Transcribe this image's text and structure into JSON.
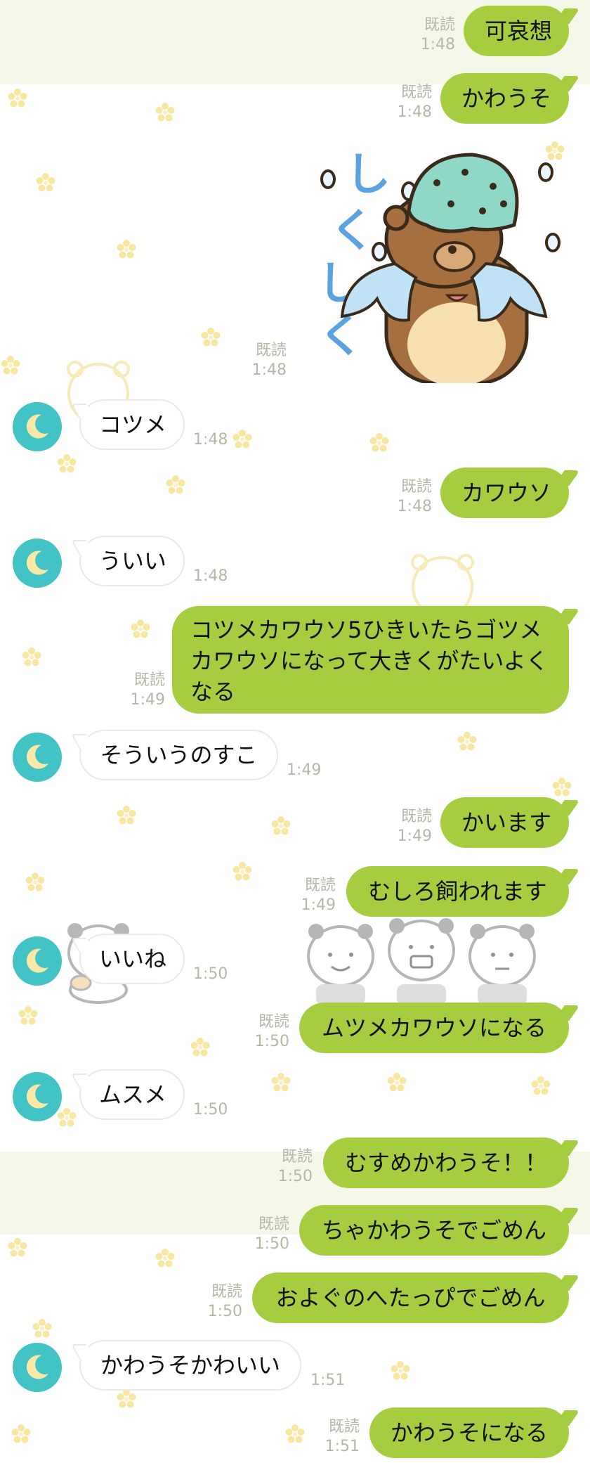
{
  "theme": {
    "my_bubble": "#a6cd3f",
    "their_bubble": "#ffffff",
    "avatar": "#42c3c6",
    "meta_text": "#b7b7a8"
  },
  "messages": [
    {
      "from": "me",
      "text": "可哀想",
      "read": "既読",
      "time": "1:48"
    },
    {
      "from": "me",
      "text": "かわうそ",
      "read": "既読",
      "time": "1:48"
    },
    {
      "from": "me",
      "sticker": "crying-bear-icecream-sticker",
      "sticker_text": "しくしく",
      "read": "既読",
      "time": "1:48"
    },
    {
      "from": "them",
      "text": "コツメ",
      "time": "1:48"
    },
    {
      "from": "me",
      "text": "カワウソ",
      "read": "既読",
      "time": "1:48"
    },
    {
      "from": "them",
      "text": "ういい",
      "time": "1:48"
    },
    {
      "from": "me",
      "text": "コツメカワウソ5ひきいたらゴツメカワウソになって大きくがたいよくなる",
      "read": "既読",
      "time": "1:49"
    },
    {
      "from": "them",
      "text": "そういうのすこ",
      "time": "1:49"
    },
    {
      "from": "me",
      "text": "かいます",
      "read": "既読",
      "time": "1:49"
    },
    {
      "from": "me",
      "text": "むしろ飼われます",
      "read": "既読",
      "time": "1:49"
    },
    {
      "from": "them",
      "text": "いいね",
      "time": "1:50"
    },
    {
      "from": "me",
      "text": "ムツメカワウソになる",
      "read": "既読",
      "time": "1:50"
    },
    {
      "from": "them",
      "text": "ムスメ",
      "time": "1:50"
    },
    {
      "from": "me",
      "text": "むすめかわうそ！！",
      "read": "既読",
      "time": "1:50"
    },
    {
      "from": "me",
      "text": "ちゃかわうそでごめん",
      "read": "既読",
      "time": "1:50"
    },
    {
      "from": "me",
      "text": "およぐのへたっぴでごめん",
      "read": "既読",
      "time": "1:50"
    },
    {
      "from": "them",
      "text": "かわうそかわいい",
      "time": "1:51"
    },
    {
      "from": "me",
      "text": "かわうそになる",
      "read": "既読",
      "time": "1:51"
    }
  ]
}
